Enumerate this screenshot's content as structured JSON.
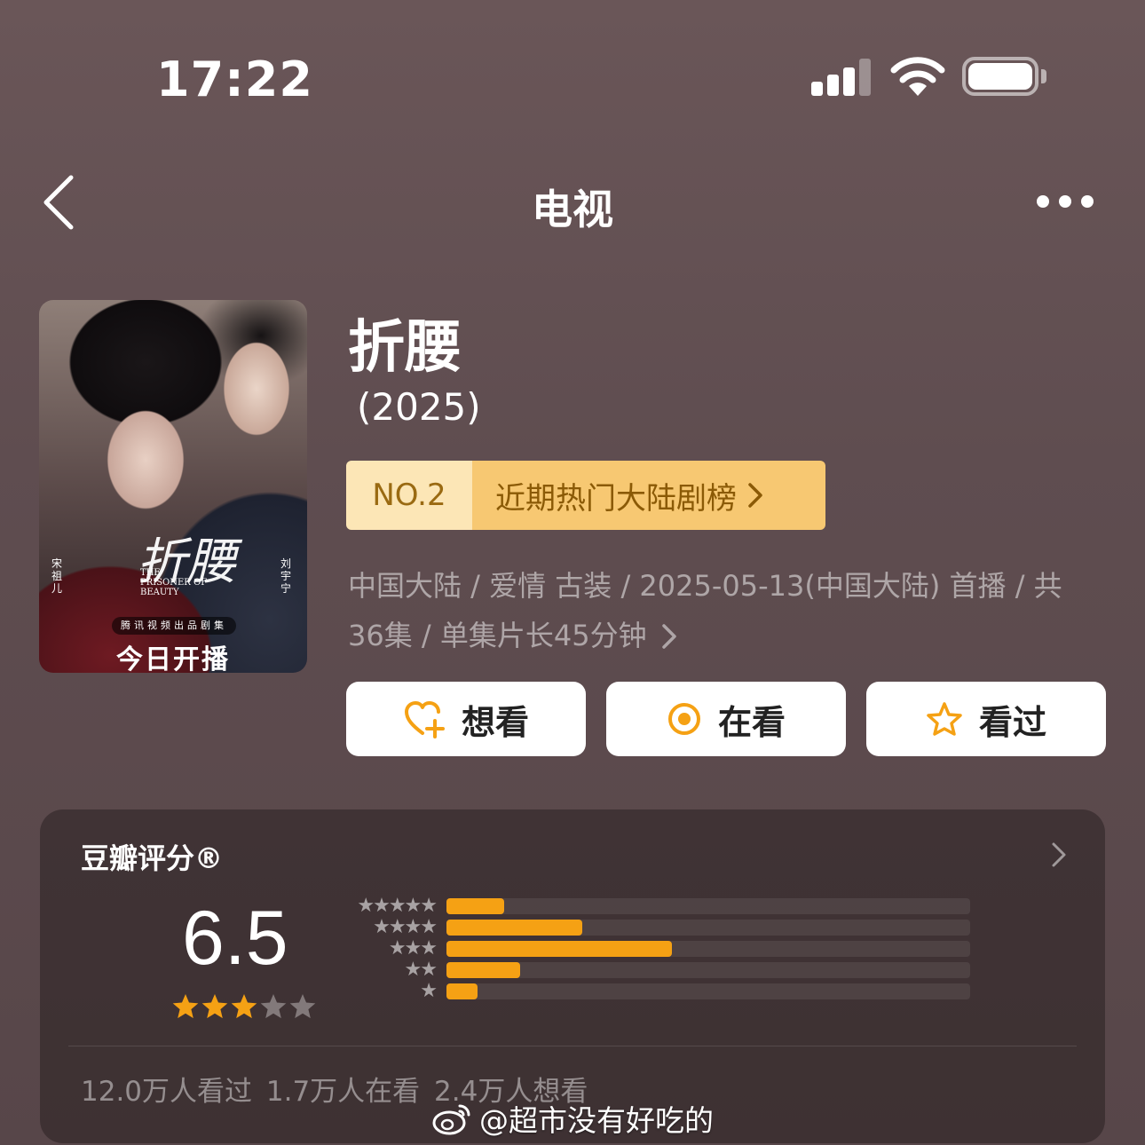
{
  "status_bar": {
    "time": "17:22"
  },
  "nav": {
    "title": "电视"
  },
  "poster": {
    "calligraphy_title": "折腰",
    "english_title": "THE PRISONER OF BEAUTY",
    "actor_left": "宋祖儿",
    "actor_right": "刘宇宁",
    "producer": "腾讯视频出品剧集",
    "premiere_text": "今日开播"
  },
  "show": {
    "title": "折腰",
    "year": "(2025)",
    "rank_no": "NO.2",
    "rank_list": "近期热门大陆剧榜",
    "meta": "中国大陆 / 爱情 古装 / 2025-05-13(中国大陆) 首播 / 共36集 / 单集片长45分钟"
  },
  "actions": {
    "want": "想看",
    "watching": "在看",
    "watched": "看过"
  },
  "rating": {
    "title": "豆瓣评分®",
    "score": "6.5",
    "score_stars": 3,
    "distribution": [
      {
        "stars": "★★★★★",
        "fraction": 0.11
      },
      {
        "stars": "★★★★",
        "fraction": 0.26
      },
      {
        "stars": "★★★",
        "fraction": 0.43
      },
      {
        "stars": "★★",
        "fraction": 0.14
      },
      {
        "stars": "★",
        "fraction": 0.06
      }
    ],
    "counts": "12.0万人看过   1.7万人在看   2.4万人想看"
  },
  "watermark": "@超市没有好吃的",
  "colors": {
    "accent": "#f5a114",
    "rank_bg": "#f7c872",
    "rank_no_bg": "#fce6b6"
  }
}
